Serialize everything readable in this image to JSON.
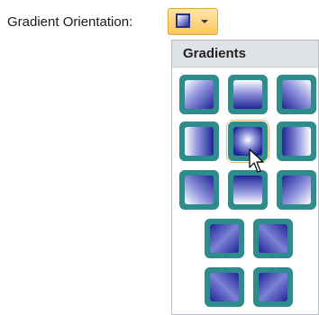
{
  "label": "Gradient Orientation:",
  "dropdown": {
    "title": "Gradients",
    "accent_color": "#2f8c8c",
    "gradient_color": "#1f2596"
  },
  "selected_gradient": "center",
  "gradients": [
    "top-left",
    "top",
    "top-right",
    "left",
    "center",
    "right",
    "bottom-left",
    "bottom",
    "bottom-right",
    "diagonal-1",
    "diagonal-2",
    "diagonal-3",
    "diagonal-4"
  ]
}
